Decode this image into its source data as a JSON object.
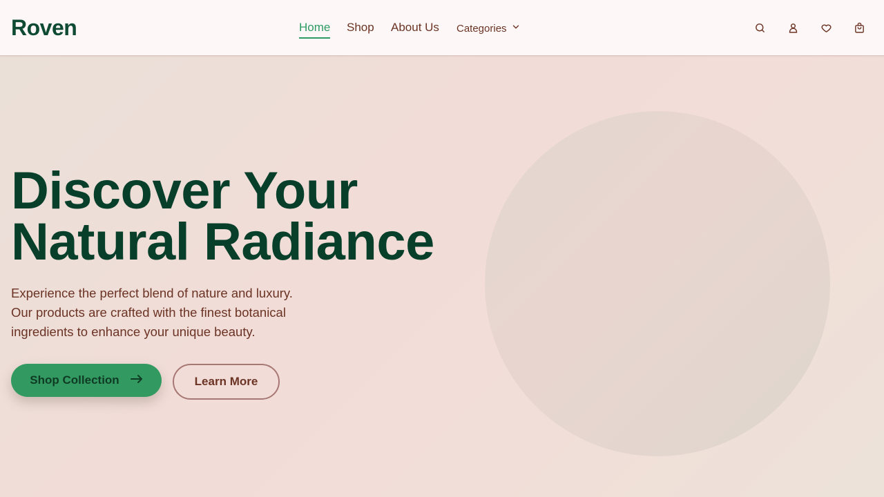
{
  "brand": {
    "logo": "Roven"
  },
  "nav": {
    "links": [
      {
        "label": "Home",
        "active": true
      },
      {
        "label": "Shop",
        "active": false
      },
      {
        "label": "About Us",
        "active": false
      }
    ],
    "categories_label": "Categories"
  },
  "header_icons": [
    "search-icon",
    "user-icon",
    "heart-icon",
    "bag-icon"
  ],
  "hero": {
    "title_line1": "Discover Your",
    "title_line2": "Natural Radiance",
    "subtitle_line1": "Experience the perfect blend of nature and luxury.",
    "subtitle_line2": "Our products are crafted with the finest botanical",
    "subtitle_line3": "ingredients to enhance your unique beauty.",
    "primary_button": "Shop Collection",
    "secondary_button": "Learn More"
  },
  "colors": {
    "brand_green": "#0f4a33",
    "accent_green": "#2e9a63",
    "text_brown": "#6b3324",
    "header_bg": "#fdf8f7"
  }
}
